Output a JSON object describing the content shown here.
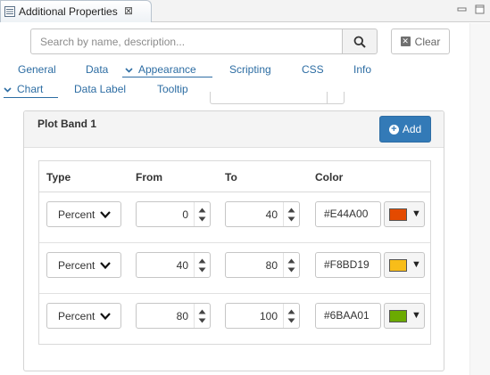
{
  "view_tab": {
    "title": "Additional Properties",
    "close_icon": "close-icon"
  },
  "search": {
    "placeholder": "Search by name, description...",
    "value": "",
    "clear_label": "Clear"
  },
  "tabs_primary": [
    {
      "label": "General",
      "active": false
    },
    {
      "label": "Data",
      "active": false
    },
    {
      "label": "Appearance",
      "active": true,
      "expanded": true
    },
    {
      "label": "Scripting",
      "active": false
    },
    {
      "label": "CSS",
      "active": false
    },
    {
      "label": "Info",
      "active": false
    }
  ],
  "tabs_secondary": [
    {
      "label": "Chart",
      "active": true,
      "expanded": true
    },
    {
      "label": "Data Label",
      "active": false
    },
    {
      "label": "Tooltip",
      "active": false
    }
  ],
  "plot_band": {
    "title": "Plot Band 1",
    "add_label": "Add",
    "columns": [
      "Type",
      "From",
      "To",
      "Color"
    ],
    "rows": [
      {
        "type": "Percent",
        "from": "0",
        "to": "40",
        "color_text": "#E44A00",
        "swatch": "#E44A00"
      },
      {
        "type": "Percent",
        "from": "40",
        "to": "80",
        "color_text": "#F8BD19",
        "swatch": "#F8BD19"
      },
      {
        "type": "Percent",
        "from": "80",
        "to": "100",
        "color_text": "#6BAA01",
        "swatch": "#6BAA01"
      }
    ]
  },
  "colors": {
    "accent": "#2D6DA3",
    "button_primary": "#337AB7"
  }
}
